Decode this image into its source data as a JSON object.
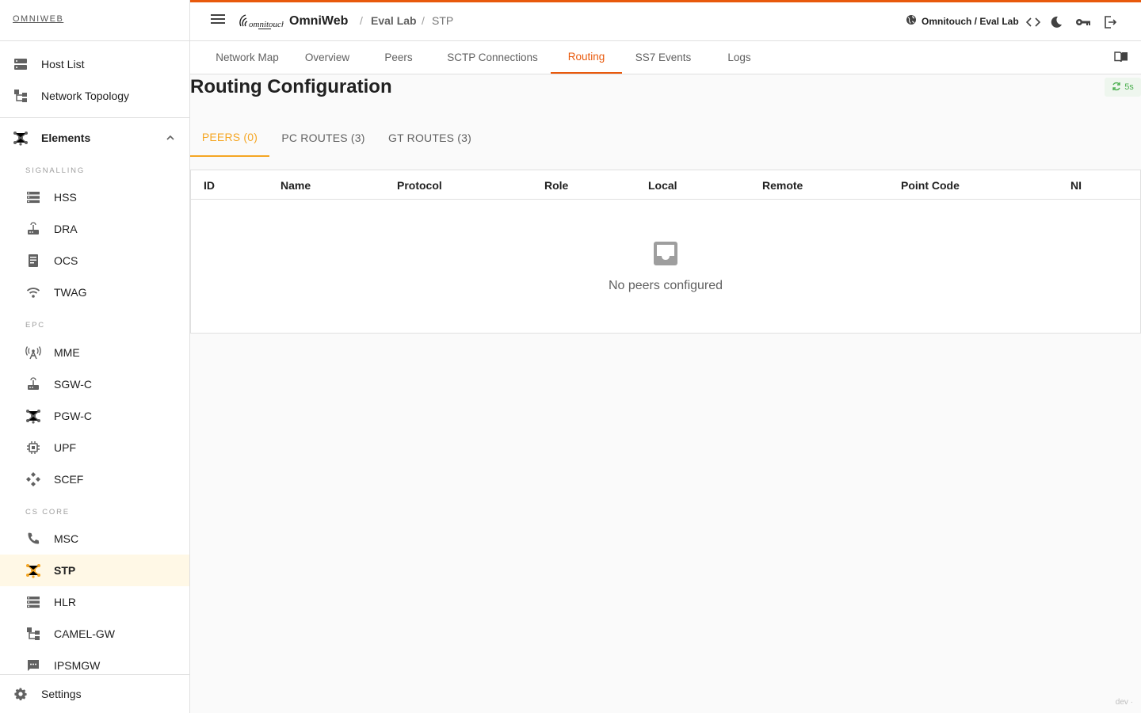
{
  "sidebar": {
    "brand": "OMNIWEB",
    "top_items": [
      {
        "label": "Host List",
        "icon": "host-list-icon"
      },
      {
        "label": "Network Topology",
        "icon": "topology-icon"
      }
    ],
    "elements_label": "Elements",
    "sections": [
      {
        "title": "SIGNALLING",
        "items": [
          "HSS",
          "DRA",
          "OCS",
          "TWAG"
        ]
      },
      {
        "title": "EPC",
        "items": [
          "MME",
          "SGW-C",
          "PGW-C",
          "UPF",
          "SCEF"
        ]
      },
      {
        "title": "CS CORE",
        "items": [
          "MSC",
          "STP",
          "HLR",
          "CAMEL-GW",
          "IPSMGW"
        ]
      }
    ],
    "active_item": "STP",
    "settings_label": "Settings"
  },
  "topbar": {
    "app_name": "OmniWeb",
    "breadcrumb": [
      "Eval Lab",
      "STP"
    ],
    "org": "Omnitouch / Eval Lab"
  },
  "subnav": {
    "tabs": [
      "Network Map",
      "Overview",
      "Peers",
      "SCTP Connections",
      "Routing",
      "SS7 Events",
      "Logs"
    ],
    "active": "Routing"
  },
  "main": {
    "title": "Routing Configuration",
    "refresh_interval": "5s",
    "tabs": [
      "PEERS (0)",
      "PC ROUTES (3)",
      "GT ROUTES (3)"
    ],
    "active_tab": "PEERS (0)",
    "table": {
      "columns": [
        "ID",
        "Name",
        "Protocol",
        "Role",
        "Local",
        "Remote",
        "Point Code",
        "NI"
      ],
      "empty_message": "No peers configured"
    }
  },
  "footer": {
    "env": "dev ·"
  },
  "colors": {
    "accent": "#e8590c",
    "tab_active": "#f5a623",
    "sidebar_active_bg": "#fff8e6",
    "refresh": "#4caf50"
  }
}
